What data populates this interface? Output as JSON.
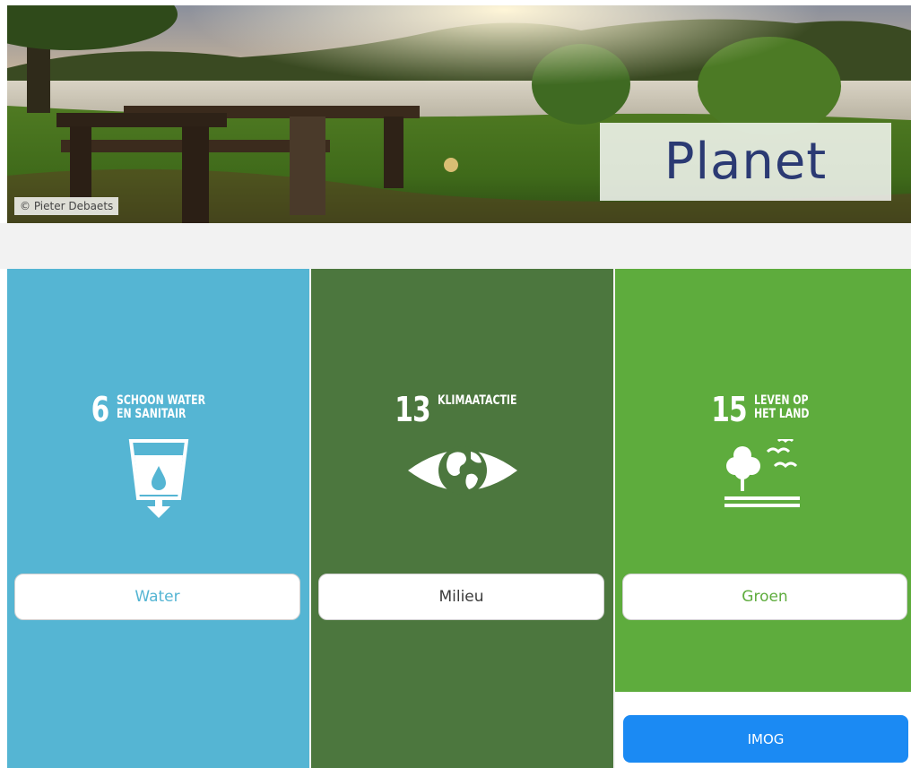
{
  "hero": {
    "title": "Planet",
    "photo_credit": "© Pieter Debaets"
  },
  "cards": [
    {
      "id": "water",
      "goal_number": "6",
      "goal_title": "SCHOON WATER\nEN SANITAIR",
      "icon": "water-cup-icon",
      "button_label": "Water",
      "color": "#55b5d3"
    },
    {
      "id": "climate",
      "goal_number": "13",
      "goal_title": "KLIMAATACTIE",
      "icon": "earth-eye-icon",
      "button_label": "Milieu",
      "color": "#4c773e"
    },
    {
      "id": "land",
      "goal_number": "15",
      "goal_title": "LEVEN OP\nHET LAND",
      "icon": "tree-birds-icon",
      "button_label": "Groen",
      "color": "#5eac3d"
    }
  ],
  "imog_button": {
    "label": "IMOG",
    "color": "#1b8af3"
  }
}
